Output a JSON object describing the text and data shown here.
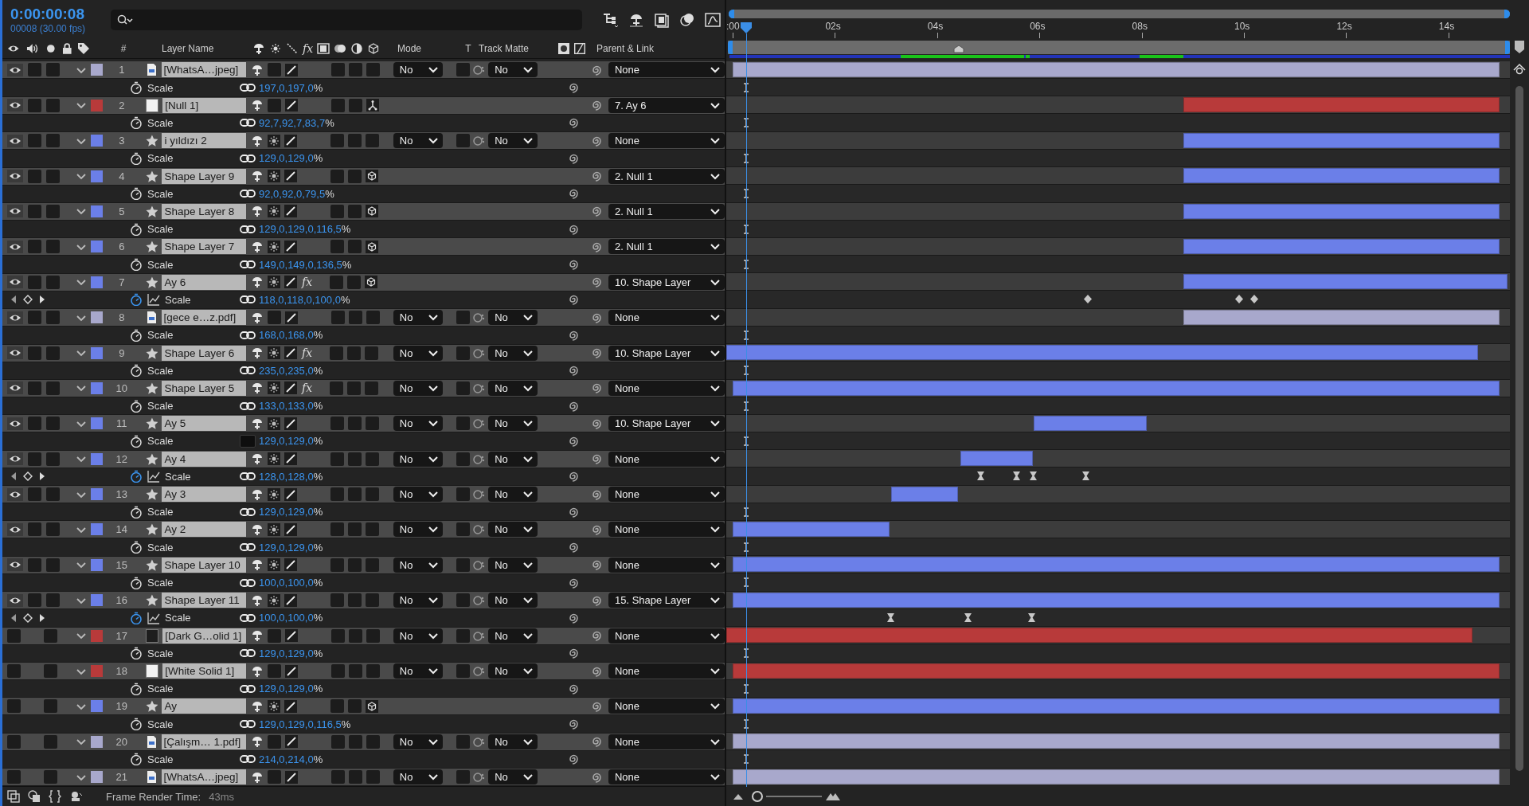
{
  "time": {
    "current": "0:00:00:08",
    "frames": "00008 (30.00 fps)"
  },
  "columns": {
    "number": "#",
    "layer_name": "Layer Name",
    "effects": "fx",
    "mode": "Mode",
    "t": "T",
    "track_matte": "Track Matte",
    "parent": "Parent & Link"
  },
  "ruler": {
    "labels": [
      ":00",
      "02s",
      "04s",
      "06s",
      "08s",
      "10s",
      "12s",
      "14s"
    ]
  },
  "layers": [
    {
      "index": "1",
      "kind": "footage",
      "name": "[WhatsA…jpeg]",
      "color": "#a8a8cc",
      "visible": true,
      "three_d": false,
      "mode": "No",
      "track_matte": "No",
      "parent": "None",
      "property": {
        "name": "Scale",
        "value": "197,0,197,0",
        "unit": "%",
        "linked": true,
        "keyframed": false
      }
    },
    {
      "index": "2",
      "kind": "null",
      "name": "[Null 1]",
      "color": "#b83a3a",
      "visible": true,
      "three_d": false,
      "parent": "7. Ay 6",
      "property": {
        "name": "Scale",
        "value": "92,7,92,7,83,7",
        "unit": "%",
        "linked": true,
        "keyframed": false
      }
    },
    {
      "index": "3",
      "kind": "shape",
      "name": "i yıldızı 2",
      "color": "#6b7fe8",
      "visible": true,
      "three_d": false,
      "mode": "No",
      "track_matte": "No",
      "parent": "None",
      "property": {
        "name": "Scale",
        "value": "129,0,129,0",
        "unit": "%",
        "linked": true,
        "keyframed": false
      }
    },
    {
      "index": "4",
      "kind": "shape",
      "name": "Shape Layer 9",
      "color": "#6b7fe8",
      "visible": true,
      "three_d": true,
      "parent": "2. Null 1",
      "property": {
        "name": "Scale",
        "value": "92,0,92,0,79,5",
        "unit": "%",
        "linked": true,
        "keyframed": false
      }
    },
    {
      "index": "5",
      "kind": "shape",
      "name": "Shape Layer 8",
      "color": "#6b7fe8",
      "visible": true,
      "three_d": true,
      "parent": "2. Null 1",
      "property": {
        "name": "Scale",
        "value": "129,0,129,0,116,5",
        "unit": "%",
        "linked": true,
        "keyframed": false
      }
    },
    {
      "index": "6",
      "kind": "shape",
      "name": "Shape Layer 7",
      "color": "#6b7fe8",
      "visible": true,
      "three_d": true,
      "parent": "2. Null 1",
      "property": {
        "name": "Scale",
        "value": "149,0,149,0,136,5",
        "unit": "%",
        "linked": true,
        "keyframed": false
      }
    },
    {
      "index": "7",
      "kind": "shape",
      "name": "Ay 6",
      "color": "#6b7fe8",
      "visible": true,
      "three_d": true,
      "effects": {
        "label": "fx",
        "enabled": true
      },
      "parent": "10. Shape Layer",
      "property": {
        "name": "Scale",
        "value": "118,0,118,0,100,0",
        "unit": "%",
        "linked": true,
        "keyframed": true,
        "keyframes": [
          {
            "kind": "linear"
          },
          {
            "kind": "linear"
          },
          {
            "kind": "linear"
          }
        ]
      }
    },
    {
      "index": "8",
      "kind": "footage",
      "name": "[gece e…z.pdf]",
      "color": "#a8a8cc",
      "visible": true,
      "three_d": false,
      "mode": "No",
      "track_matte": "No",
      "parent": "None",
      "property": {
        "name": "Scale",
        "value": "168,0,168,0",
        "unit": "%",
        "linked": true,
        "keyframed": false
      }
    },
    {
      "index": "9",
      "kind": "shape",
      "name": "Shape Layer 6",
      "color": "#6b7fe8",
      "visible": true,
      "three_d": false,
      "effects": {
        "label": "fx",
        "enabled": true
      },
      "mode": "No",
      "track_matte": "No",
      "parent": "10. Shape Layer",
      "property": {
        "name": "Scale",
        "value": "235,0,235,0",
        "unit": "%",
        "linked": true,
        "keyframed": false
      }
    },
    {
      "index": "10",
      "kind": "shape",
      "name": "Shape Layer 5",
      "color": "#6b7fe8",
      "visible": true,
      "three_d": false,
      "effects": {
        "label": "fx",
        "enabled": true
      },
      "mode": "No",
      "track_matte": "No",
      "parent": "None",
      "property": {
        "name": "Scale",
        "value": "133,0,133,0",
        "unit": "%",
        "linked": true,
        "keyframed": false
      }
    },
    {
      "index": "11",
      "kind": "shape",
      "name": "Ay 5",
      "color": "#6b7fe8",
      "visible": true,
      "three_d": false,
      "mode": "No",
      "track_matte": "No",
      "parent": "10. Shape Layer",
      "property": {
        "name": "Scale",
        "value": "129,0,129,0",
        "unit": "%",
        "linked": false,
        "keyframed": false
      }
    },
    {
      "index": "12",
      "kind": "shape",
      "name": "Ay 4",
      "color": "#6b7fe8",
      "visible": true,
      "three_d": false,
      "mode": "No",
      "track_matte": "No",
      "parent": "None",
      "property": {
        "name": "Scale",
        "value": "128,0,128,0",
        "unit": "%",
        "linked": true,
        "keyframed": true,
        "keyframes": [
          {
            "kind": "ease"
          },
          {
            "kind": "ease"
          },
          {
            "kind": "ease"
          },
          {
            "kind": "ease"
          }
        ]
      }
    },
    {
      "index": "13",
      "kind": "shape",
      "name": "Ay 3",
      "color": "#6b7fe8",
      "visible": true,
      "three_d": false,
      "mode": "No",
      "track_matte": "No",
      "parent": "None",
      "property": {
        "name": "Scale",
        "value": "129,0,129,0",
        "unit": "%",
        "linked": true,
        "keyframed": false
      }
    },
    {
      "index": "14",
      "kind": "shape",
      "name": "Ay 2",
      "color": "#6b7fe8",
      "visible": true,
      "three_d": false,
      "mode": "No",
      "track_matte": "No",
      "parent": "None",
      "property": {
        "name": "Scale",
        "value": "129,0,129,0",
        "unit": "%",
        "linked": true,
        "keyframed": false
      }
    },
    {
      "index": "15",
      "kind": "shape",
      "name": "Shape Layer 10",
      "color": "#6b7fe8",
      "visible": true,
      "three_d": false,
      "mode": "No",
      "track_matte": "No",
      "parent": "None",
      "property": {
        "name": "Scale",
        "value": "100,0,100,0",
        "unit": "%",
        "linked": true,
        "keyframed": false
      }
    },
    {
      "index": "16",
      "kind": "shape",
      "name": "Shape Layer 11",
      "color": "#6b7fe8",
      "visible": true,
      "three_d": false,
      "mode": "No",
      "track_matte": "No",
      "parent": "15. Shape Layer",
      "property": {
        "name": "Scale",
        "value": "100,0,100,0",
        "unit": "%",
        "linked": true,
        "keyframed": true,
        "keyframes": [
          {
            "kind": "ease"
          },
          {
            "kind": "ease"
          },
          {
            "kind": "ease"
          }
        ]
      }
    },
    {
      "index": "17",
      "kind": "solid_dark",
      "name": "[Dark G…olid 1]",
      "color": "#b83a3a",
      "visible": false,
      "three_d": false,
      "mode": "No",
      "track_matte": "No",
      "parent": "None",
      "property": {
        "name": "Scale",
        "value": "129,0,129,0",
        "unit": "%",
        "linked": true,
        "keyframed": false
      }
    },
    {
      "index": "18",
      "kind": "solid_white",
      "name": "[White Solid 1]",
      "color": "#b83a3a",
      "visible": false,
      "three_d": false,
      "mode": "No",
      "track_matte": "No",
      "parent": "None",
      "property": {
        "name": "Scale",
        "value": "129,0,129,0",
        "unit": "%",
        "linked": true,
        "keyframed": false
      }
    },
    {
      "index": "19",
      "kind": "shape",
      "name": "Ay",
      "color": "#6b7fe8",
      "visible": false,
      "three_d": true,
      "parent": "None",
      "property": {
        "name": "Scale",
        "value": "129,0,129,0,116,5",
        "unit": "%",
        "linked": true,
        "keyframed": false
      }
    },
    {
      "index": "20",
      "kind": "footage",
      "name": "[Çalışm… 1.pdf]",
      "color": "#a8a8cc",
      "visible": false,
      "three_d": false,
      "mode": "No",
      "track_matte": "No",
      "parent": "None",
      "property": {
        "name": "Scale",
        "value": "214,0,214,0",
        "unit": "%",
        "linked": true,
        "keyframed": false
      }
    },
    {
      "index": "21",
      "kind": "footage",
      "name": "[WhatsA…jpeg]",
      "color": "#a8a8cc",
      "visible": false,
      "three_d": false,
      "mode": "No",
      "track_matte": "No",
      "parent": "None"
    }
  ],
  "footer": {
    "label": "Frame Render Time:",
    "value": "43ms"
  }
}
